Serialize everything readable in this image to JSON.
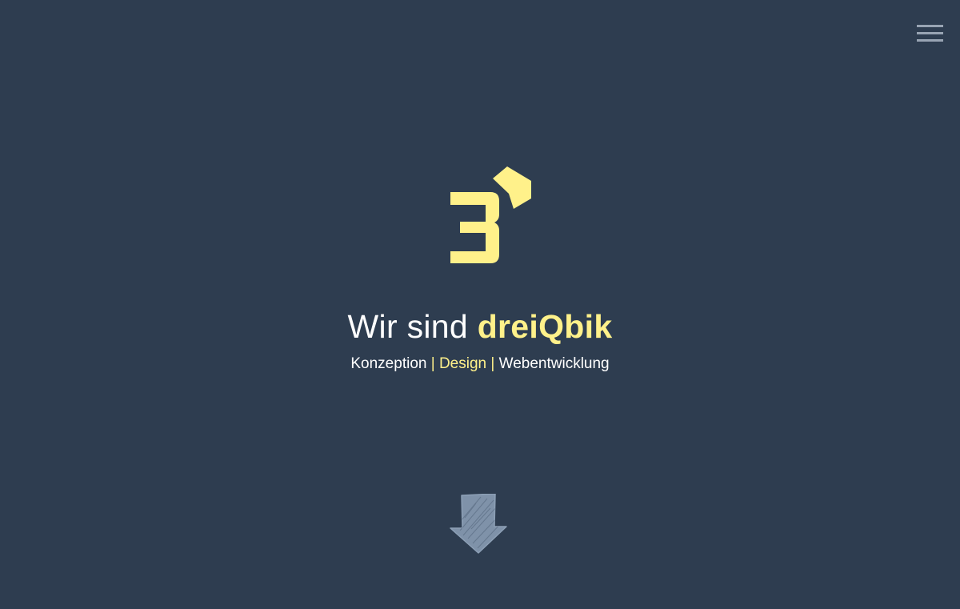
{
  "nav": {
    "menu_icon": "hamburger-menu-icon"
  },
  "logo": {
    "icon": "dreiqbik-logo-3"
  },
  "hero": {
    "headline_prefix": "Wir sind ",
    "headline_brand": "dreiQbik",
    "services": {
      "item1": "Konzeption",
      "separator1": " | ",
      "item2": "Design",
      "separator2": " | ",
      "item3": "Webentwicklung"
    }
  },
  "scroll": {
    "icon": "arrow-down-icon"
  },
  "colors": {
    "background": "#2e3d50",
    "accent": "#fff18a",
    "text": "#ffffff",
    "muted": "#98a4b3"
  }
}
